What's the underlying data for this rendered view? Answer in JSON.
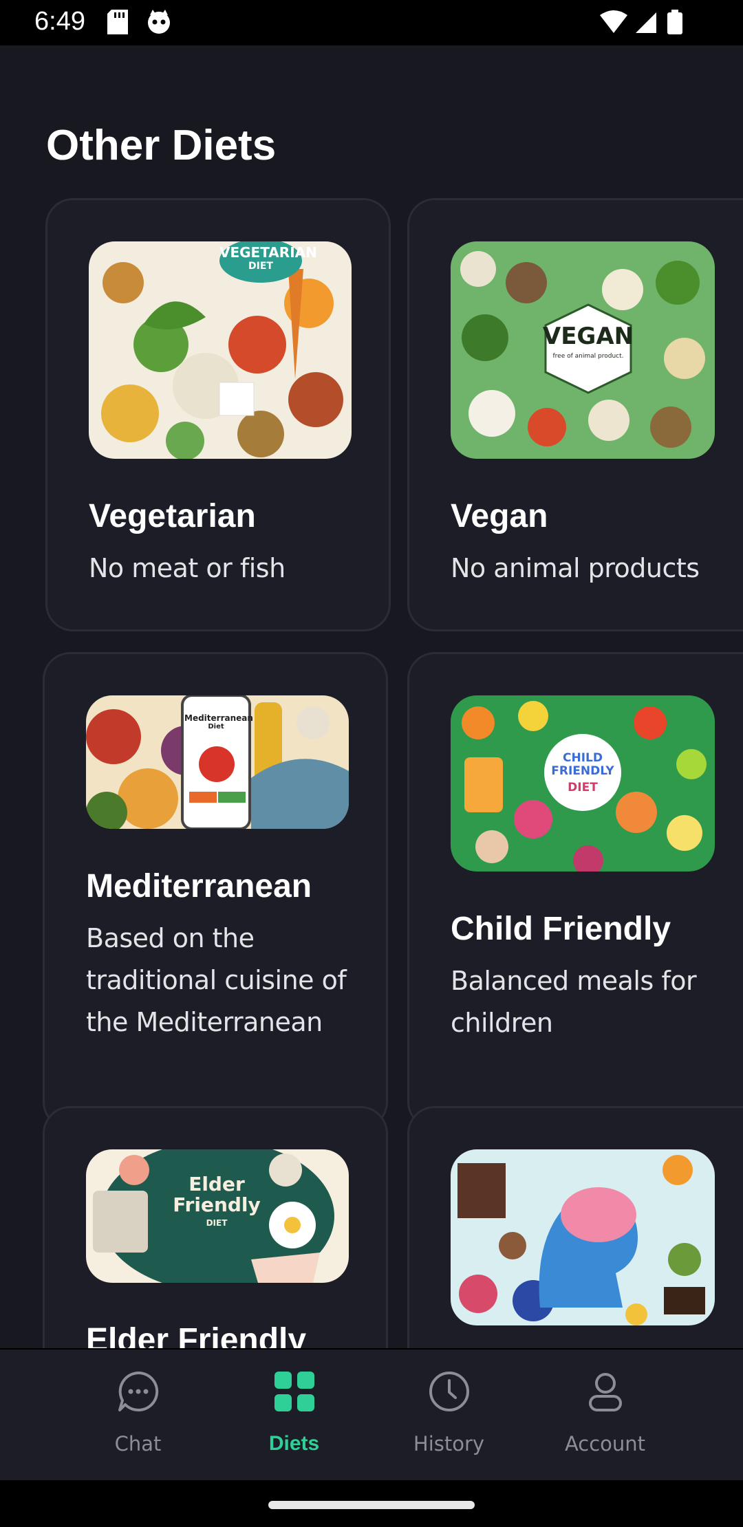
{
  "status_bar": {
    "time": "6:49",
    "left_icons": [
      "sd-card-icon",
      "app-notification-icon"
    ],
    "right_icons": [
      "wifi-icon",
      "cell-signal-icon",
      "battery-icon"
    ]
  },
  "page": {
    "title": "Other Diets"
  },
  "diets": [
    {
      "title": "Vegetarian",
      "description": "No meat or fish",
      "image_label": "VEGETARIAN",
      "image_sublabel": "DIET",
      "image_theme": "#2a9d8f"
    },
    {
      "title": "Vegan",
      "description": "No animal products",
      "image_label": "VEGAN",
      "image_sublabel": "free of animal product.",
      "image_theme": "#5caf5a"
    },
    {
      "title": "Mediterranean",
      "description": "Based on the traditional cuisine of the Mediterranean",
      "image_label": "Mediterranean",
      "image_sublabel": "Diet",
      "image_theme": "#e07a3a"
    },
    {
      "title": "Child Friendly",
      "description": "Balanced meals for children",
      "image_label": "CHILD FRIENDLY",
      "image_sublabel": "DIET",
      "image_theme": "#2f9a4c"
    },
    {
      "title": "Elder Friendly",
      "description": "",
      "image_label": "Elder Friendly",
      "image_sublabel": "DIET",
      "image_theme": "#1f5a4e"
    },
    {
      "title": "",
      "description": "",
      "image_label": "",
      "image_sublabel": "",
      "image_theme": "#79c4d8"
    }
  ],
  "bottom_nav": {
    "items": [
      {
        "label": "Chat",
        "icon": "chat-bubble-icon",
        "active": false
      },
      {
        "label": "Diets",
        "icon": "grid-icon",
        "active": true
      },
      {
        "label": "History",
        "icon": "clock-icon",
        "active": false
      },
      {
        "label": "Account",
        "icon": "person-icon",
        "active": false
      }
    ]
  },
  "colors": {
    "background": "#171820",
    "card": "#1c1d26",
    "card_border": "#2a2c36",
    "accent": "#2fcf98",
    "nav_inactive": "#8c8d96"
  }
}
